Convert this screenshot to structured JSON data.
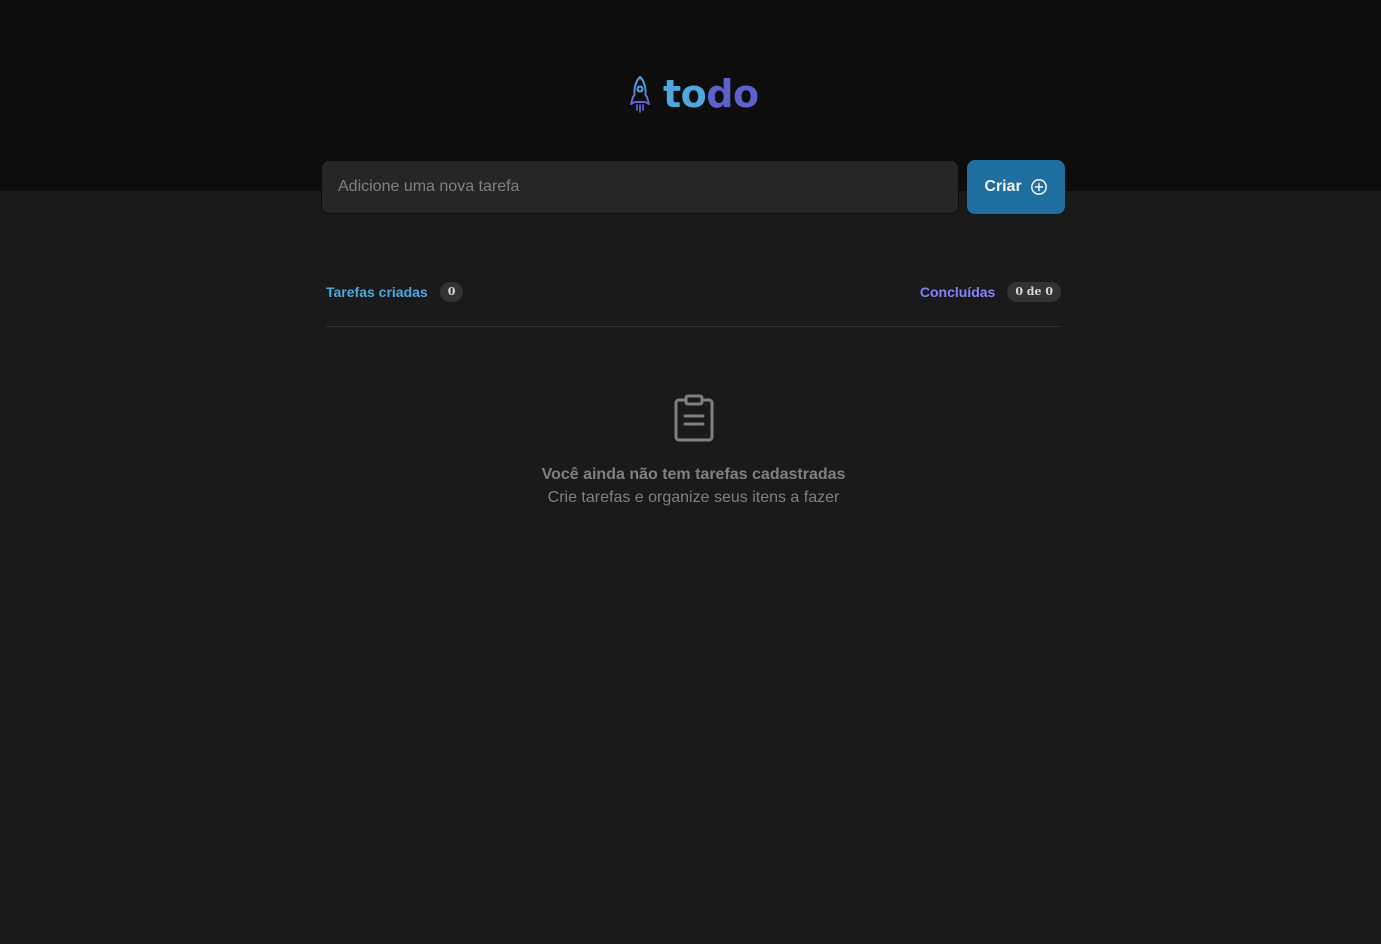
{
  "app": {
    "logo_part1": "to",
    "logo_part2": "do",
    "icon": "rocket-icon"
  },
  "form": {
    "input_placeholder": "Adicione uma nova tarefa",
    "input_value": "",
    "create_label": "Criar",
    "create_icon": "plus-circle-icon"
  },
  "counters": {
    "created_label": "Tarefas criadas",
    "created_count": "0",
    "done_label": "Concluídas",
    "done_count": "0 de 0"
  },
  "empty": {
    "icon": "clipboard-icon",
    "title": "Você ainda não tem tarefas cadastradas",
    "subtitle": "Crie tarefas e organize seus itens a fazer"
  },
  "colors": {
    "header_bg": "#0d0d0d",
    "page_bg": "#1a1a1a",
    "blue": "#4ea8de",
    "blue_dark": "#1e6f9f",
    "purple": "#5e60ce",
    "purple_light": "#8284fa",
    "gray_text": "#808080"
  }
}
